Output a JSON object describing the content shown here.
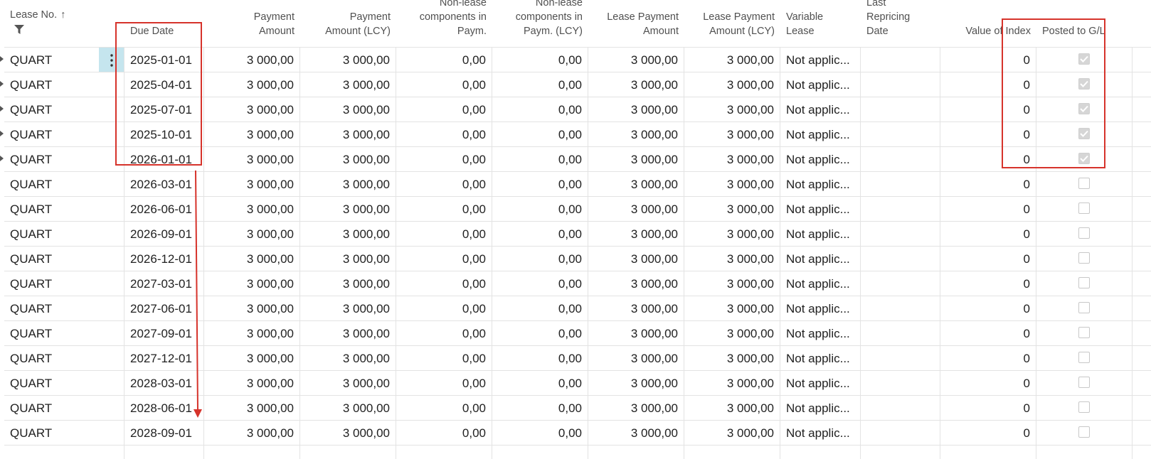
{
  "headers": {
    "lease_no": "Lease No.",
    "sort_indicator": "↑",
    "due_date": "Due Date",
    "payment_amount": [
      "Payment",
      "Amount"
    ],
    "payment_amount_lcy": [
      "Payment",
      "Amount (LCY)"
    ],
    "non_lease": [
      "Non-lease",
      "components in",
      "Paym."
    ],
    "non_lease_lcy": [
      "Non-lease",
      "components in",
      "Paym. (LCY)"
    ],
    "lease_payment_amount": [
      "Lease Payment",
      "Amount"
    ],
    "lease_payment_amount_lcy": [
      "Lease Payment",
      "Amount (LCY)"
    ],
    "variable_lease": [
      "Variable",
      "Lease"
    ],
    "last_repricing_date": [
      "Last",
      "Repricing",
      "Date"
    ],
    "value_of_index": "Value of Index",
    "posted_to_gl": "Posted to G/L"
  },
  "icons": {
    "filter": "filter-icon",
    "row_actions": "ellipsis-vertical-icon",
    "row_marker": "caret-right-icon"
  },
  "colors": {
    "highlight": "#d6332b",
    "active_cell": "#c5e5ee"
  },
  "rows": [
    {
      "lease_no": "QUART",
      "due_date": "2025-01-01",
      "payment_amount": "3 000,00",
      "payment_amount_lcy": "3 000,00",
      "non_lease": "0,00",
      "non_lease_lcy": "0,00",
      "lease_payment_amount": "3 000,00",
      "lease_payment_amount_lcy": "3 000,00",
      "variable_lease": "Not applic...",
      "last_repricing_date": "",
      "value_of_index": "0",
      "posted": true
    },
    {
      "lease_no": "QUART",
      "due_date": "2025-04-01",
      "payment_amount": "3 000,00",
      "payment_amount_lcy": "3 000,00",
      "non_lease": "0,00",
      "non_lease_lcy": "0,00",
      "lease_payment_amount": "3 000,00",
      "lease_payment_amount_lcy": "3 000,00",
      "variable_lease": "Not applic...",
      "last_repricing_date": "",
      "value_of_index": "0",
      "posted": true
    },
    {
      "lease_no": "QUART",
      "due_date": "2025-07-01",
      "payment_amount": "3 000,00",
      "payment_amount_lcy": "3 000,00",
      "non_lease": "0,00",
      "non_lease_lcy": "0,00",
      "lease_payment_amount": "3 000,00",
      "lease_payment_amount_lcy": "3 000,00",
      "variable_lease": "Not applic...",
      "last_repricing_date": "",
      "value_of_index": "0",
      "posted": true
    },
    {
      "lease_no": "QUART",
      "due_date": "2025-10-01",
      "payment_amount": "3 000,00",
      "payment_amount_lcy": "3 000,00",
      "non_lease": "0,00",
      "non_lease_lcy": "0,00",
      "lease_payment_amount": "3 000,00",
      "lease_payment_amount_lcy": "3 000,00",
      "variable_lease": "Not applic...",
      "last_repricing_date": "",
      "value_of_index": "0",
      "posted": true
    },
    {
      "lease_no": "QUART",
      "due_date": "2026-01-01",
      "payment_amount": "3 000,00",
      "payment_amount_lcy": "3 000,00",
      "non_lease": "0,00",
      "non_lease_lcy": "0,00",
      "lease_payment_amount": "3 000,00",
      "lease_payment_amount_lcy": "3 000,00",
      "variable_lease": "Not applic...",
      "last_repricing_date": "",
      "value_of_index": "0",
      "posted": true
    },
    {
      "lease_no": "QUART",
      "due_date": "2026-03-01",
      "payment_amount": "3 000,00",
      "payment_amount_lcy": "3 000,00",
      "non_lease": "0,00",
      "non_lease_lcy": "0,00",
      "lease_payment_amount": "3 000,00",
      "lease_payment_amount_lcy": "3 000,00",
      "variable_lease": "Not applic...",
      "last_repricing_date": "",
      "value_of_index": "0",
      "posted": false
    },
    {
      "lease_no": "QUART",
      "due_date": "2026-06-01",
      "payment_amount": "3 000,00",
      "payment_amount_lcy": "3 000,00",
      "non_lease": "0,00",
      "non_lease_lcy": "0,00",
      "lease_payment_amount": "3 000,00",
      "lease_payment_amount_lcy": "3 000,00",
      "variable_lease": "Not applic...",
      "last_repricing_date": "",
      "value_of_index": "0",
      "posted": false
    },
    {
      "lease_no": "QUART",
      "due_date": "2026-09-01",
      "payment_amount": "3 000,00",
      "payment_amount_lcy": "3 000,00",
      "non_lease": "0,00",
      "non_lease_lcy": "0,00",
      "lease_payment_amount": "3 000,00",
      "lease_payment_amount_lcy": "3 000,00",
      "variable_lease": "Not applic...",
      "last_repricing_date": "",
      "value_of_index": "0",
      "posted": false
    },
    {
      "lease_no": "QUART",
      "due_date": "2026-12-01",
      "payment_amount": "3 000,00",
      "payment_amount_lcy": "3 000,00",
      "non_lease": "0,00",
      "non_lease_lcy": "0,00",
      "lease_payment_amount": "3 000,00",
      "lease_payment_amount_lcy": "3 000,00",
      "variable_lease": "Not applic...",
      "last_repricing_date": "",
      "value_of_index": "0",
      "posted": false
    },
    {
      "lease_no": "QUART",
      "due_date": "2027-03-01",
      "payment_amount": "3 000,00",
      "payment_amount_lcy": "3 000,00",
      "non_lease": "0,00",
      "non_lease_lcy": "0,00",
      "lease_payment_amount": "3 000,00",
      "lease_payment_amount_lcy": "3 000,00",
      "variable_lease": "Not applic...",
      "last_repricing_date": "",
      "value_of_index": "0",
      "posted": false
    },
    {
      "lease_no": "QUART",
      "due_date": "2027-06-01",
      "payment_amount": "3 000,00",
      "payment_amount_lcy": "3 000,00",
      "non_lease": "0,00",
      "non_lease_lcy": "0,00",
      "lease_payment_amount": "3 000,00",
      "lease_payment_amount_lcy": "3 000,00",
      "variable_lease": "Not applic...",
      "last_repricing_date": "",
      "value_of_index": "0",
      "posted": false
    },
    {
      "lease_no": "QUART",
      "due_date": "2027-09-01",
      "payment_amount": "3 000,00",
      "payment_amount_lcy": "3 000,00",
      "non_lease": "0,00",
      "non_lease_lcy": "0,00",
      "lease_payment_amount": "3 000,00",
      "lease_payment_amount_lcy": "3 000,00",
      "variable_lease": "Not applic...",
      "last_repricing_date": "",
      "value_of_index": "0",
      "posted": false
    },
    {
      "lease_no": "QUART",
      "due_date": "2027-12-01",
      "payment_amount": "3 000,00",
      "payment_amount_lcy": "3 000,00",
      "non_lease": "0,00",
      "non_lease_lcy": "0,00",
      "lease_payment_amount": "3 000,00",
      "lease_payment_amount_lcy": "3 000,00",
      "variable_lease": "Not applic...",
      "last_repricing_date": "",
      "value_of_index": "0",
      "posted": false
    },
    {
      "lease_no": "QUART",
      "due_date": "2028-03-01",
      "payment_amount": "3 000,00",
      "payment_amount_lcy": "3 000,00",
      "non_lease": "0,00",
      "non_lease_lcy": "0,00",
      "lease_payment_amount": "3 000,00",
      "lease_payment_amount_lcy": "3 000,00",
      "variable_lease": "Not applic...",
      "last_repricing_date": "",
      "value_of_index": "0",
      "posted": false
    },
    {
      "lease_no": "QUART",
      "due_date": "2028-06-01",
      "payment_amount": "3 000,00",
      "payment_amount_lcy": "3 000,00",
      "non_lease": "0,00",
      "non_lease_lcy": "0,00",
      "lease_payment_amount": "3 000,00",
      "lease_payment_amount_lcy": "3 000,00",
      "variable_lease": "Not applic...",
      "last_repricing_date": "",
      "value_of_index": "0",
      "posted": false
    },
    {
      "lease_no": "QUART",
      "due_date": "2028-09-01",
      "payment_amount": "3 000,00",
      "payment_amount_lcy": "3 000,00",
      "non_lease": "0,00",
      "non_lease_lcy": "0,00",
      "lease_payment_amount": "3 000,00",
      "lease_payment_amount_lcy": "3 000,00",
      "variable_lease": "Not applic...",
      "last_repricing_date": "",
      "value_of_index": "0",
      "posted": false
    }
  ]
}
